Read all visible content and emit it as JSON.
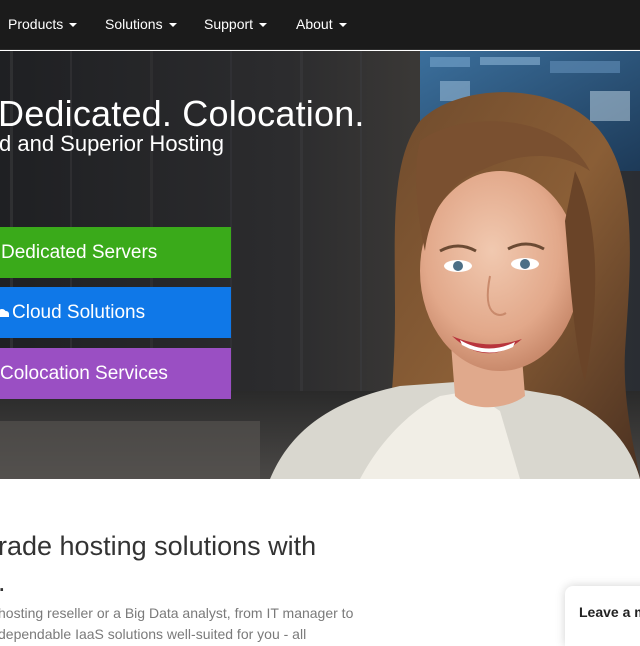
{
  "nav": {
    "items": [
      {
        "label": "Products"
      },
      {
        "label": "Solutions"
      },
      {
        "label": "Support"
      },
      {
        "label": "About"
      }
    ]
  },
  "hero": {
    "heading": "Dedicated. Colocation.",
    "subheading": "d and Superior Hosting",
    "ctas": [
      {
        "label": "Dedicated Servers",
        "color": "#3aaa1a"
      },
      {
        "label": "Cloud Solutions",
        "color": "#0f78e8",
        "icon": "cloud-icon"
      },
      {
        "label": "Colocation Services",
        "color": "#9a4fc3"
      }
    ]
  },
  "content": {
    "heading_line1": "rade hosting solutions with",
    "heading_line2": ".",
    "text_line1": "hosting reseller or a Big Data analyst, from IT manager to",
    "text_line2": "dependable IaaS solutions well-suited for you - all"
  },
  "chat": {
    "label": "Leave a m"
  }
}
